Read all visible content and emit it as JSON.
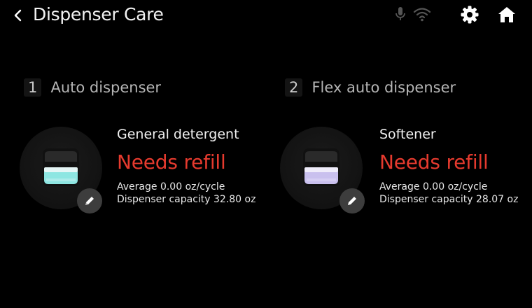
{
  "header": {
    "title": "Dispenser Care",
    "icons": [
      "back-icon",
      "mic-icon",
      "wifi-icon",
      "gear-icon",
      "home-icon"
    ]
  },
  "dispensers": [
    {
      "number": "1",
      "title": "Auto dispenser",
      "name": "General detergent",
      "status": "Needs refill",
      "average": "Average 0.00 oz/cycle",
      "capacity": "Dispenser capacity 32.80 oz"
    },
    {
      "number": "2",
      "title": "Flex auto dispenser",
      "name": "Softener",
      "status": "Needs refill",
      "average": "Average 0.00 oz/cycle",
      "capacity": "Dispenser capacity 28.07 oz"
    }
  ],
  "colors": {
    "background": "#000000",
    "status_red": "#e53a2e",
    "detergent_liquid": "#8ee6e2",
    "softener_liquid": "#c9c0ee"
  }
}
